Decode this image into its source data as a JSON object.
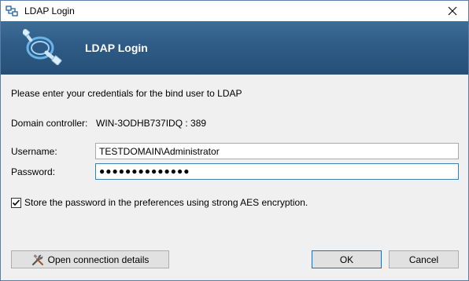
{
  "window": {
    "title": "LDAP Login",
    "close_glyph": "✕"
  },
  "banner": {
    "title": "LDAP Login",
    "icon": "network-cable-icon"
  },
  "form": {
    "instructions": "Please enter your credentials for the bind user to LDAP",
    "domain_controller_label": "Domain controller:",
    "domain_controller_value": "WIN-3ODHB737IDQ : 389",
    "username_label": "Username:",
    "username_value": "TESTDOMAIN\\Administrator",
    "password_label": "Password:",
    "password_value": "●●●●●●●●●●●●●●",
    "store_password_checked": true,
    "store_password_label": "Store the password in the preferences using strong AES encryption."
  },
  "buttons": {
    "details_label": "Open connection details",
    "ok_label": "OK",
    "cancel_label": "Cancel"
  },
  "colors": {
    "banner": "#2f5d87",
    "focus_border": "#0078d7"
  }
}
